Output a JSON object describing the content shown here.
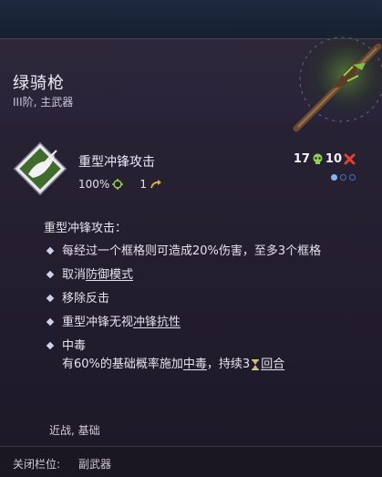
{
  "item": {
    "name": "绿骑枪",
    "subtitle": "III阶, 主武器"
  },
  "ability": {
    "name": "重型冲锋攻击",
    "accuracy": "100%",
    "speed": "1",
    "cost_green": "17",
    "cost_red": "10",
    "pips_filled": 1,
    "pips_total": 3,
    "colors": {
      "green": "#8fd14f",
      "red": "#e3402f",
      "pip": "#7fb4ff"
    },
    "icons": [
      "accuracy-icon",
      "speed-arrow-icon",
      "green-skull-icon",
      "red-cross-icon"
    ]
  },
  "description": {
    "title": "重型冲锋攻击：",
    "b1": "每经过一个框格则可造成20%伤害，至多3个框格",
    "b2_pre": "取消",
    "b2_link": "防御模式",
    "b3": "移除反击",
    "b4_pre": "重型冲锋无视",
    "b4_link": "冲锋抗性",
    "b5_title": "中毒",
    "b5_pre": "有60%的基础概率施加",
    "b5_link": "中毒",
    "b5_mid": "，持续3",
    "b5_link2": "回合"
  },
  "tags": "近战, 基础",
  "footer": {
    "label": "关闭栏位:",
    "value": "副武器"
  }
}
